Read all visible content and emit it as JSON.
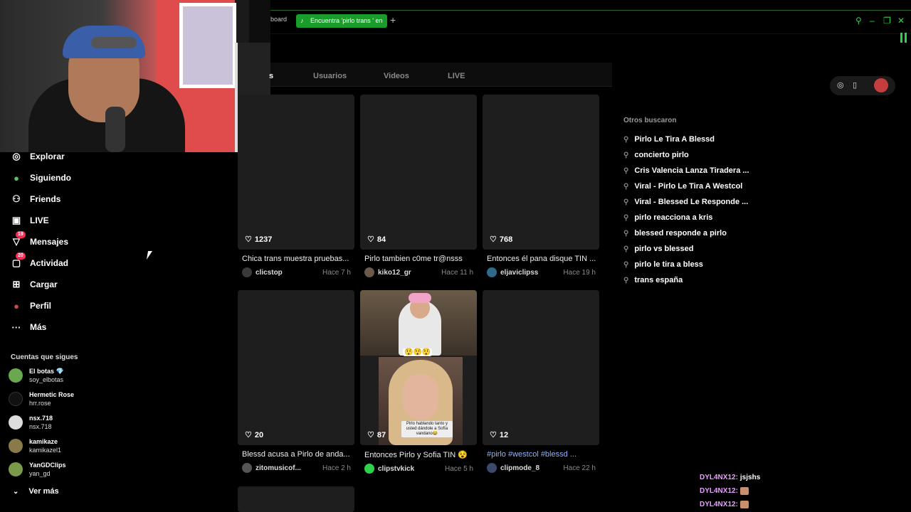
{
  "browser": {
    "prev_tab": "board",
    "active_tab": "Encuentra 'pirlo trans ' en",
    "new_tab": "+",
    "controls": [
      "⚲",
      "–",
      "❐",
      "✕"
    ]
  },
  "sidebar": {
    "items": [
      {
        "label": "Explorar",
        "icon": "compass-icon",
        "glyph": "◎"
      },
      {
        "label": "Siguiendo",
        "icon": "following-avatar-icon",
        "glyph": "●"
      },
      {
        "label": "Friends",
        "icon": "friends-icon",
        "glyph": "⚇"
      },
      {
        "label": "LIVE",
        "icon": "live-tv-icon",
        "glyph": "▣"
      },
      {
        "label": "Mensajes",
        "icon": "messages-icon",
        "glyph": "▽",
        "badge": "19"
      },
      {
        "label": "Actividad",
        "icon": "activity-icon",
        "glyph": "▢",
        "badge": "20"
      },
      {
        "label": "Cargar",
        "icon": "upload-plus-icon",
        "glyph": "⊞"
      },
      {
        "label": "Perfil",
        "icon": "profile-avatar-icon",
        "glyph": "●"
      },
      {
        "label": "Más",
        "icon": "more-dots-icon",
        "glyph": "···"
      }
    ],
    "following_title": "Cuentas que sigues",
    "following": [
      {
        "name": "El botas 💎",
        "handle": "soy_elbotas",
        "color": "#6aa84f"
      },
      {
        "name": "Hermetic Rose",
        "handle": "hrr.rose",
        "color": "#111111"
      },
      {
        "name": "nsx.718",
        "handle": "nsx.718",
        "color": "#dddddd"
      },
      {
        "name": "kamikaze",
        "handle": "kamikazel1",
        "color": "#8a7a4a"
      },
      {
        "name": "YanGDClips",
        "handle": "yan_gd",
        "color": "#7a9a4a"
      }
    ],
    "see_more": "Ver más"
  },
  "tabs": [
    "s",
    "Usuarios",
    "Videos",
    "LIVE"
  ],
  "videos": [
    {
      "likes": "1237",
      "caption": "Chica trans muestra pruebas...",
      "user": "clicstop",
      "time": "Hace 7 h"
    },
    {
      "likes": "84",
      "caption": "Pirlo tambien c0me tr@nsss",
      "user": "kiko12_gr",
      "time": "Hace 11 h"
    },
    {
      "likes": "768",
      "caption": "Entonces él pana disque TIN ...",
      "user": "eljaviclipss",
      "time": "Hace 19 h"
    },
    {
      "likes": "20",
      "caption": "Blessd acusa a Pirlo de anda...",
      "user": "zitomusicof...",
      "time": "Hace 2 h"
    },
    {
      "likes": "87",
      "caption": "Entonces Pirlo y Sofia TIN 😵",
      "user": "clipstvkick",
      "time": "Hace 5 h",
      "emojis": "😲😲😲",
      "subtitle": "Pirlo hablando tanto y usted dándole a Sofía vandano😂"
    },
    {
      "likes": "12",
      "caption": "#pirlo #westcol #blessd ...",
      "user": "clipmode_8",
      "time": "Hace 22 h"
    }
  ],
  "right": {
    "controls": [
      "◎",
      "▯"
    ],
    "others_title": "Otros buscaron",
    "suggestions": [
      "Pirlo Le Tira A Blessd",
      "concierto pirlo",
      "Cris Valencia Lanza Tiradera ...",
      "Viral - Pirlo Le Tira A Westcol",
      "Viral - Blessed Le Responde ...",
      "pirlo reacciona a kris",
      "blessed responde a pirlo",
      "pirlo vs blessed",
      "pirlo le tira a bless",
      "trans españa"
    ]
  },
  "chat": [
    {
      "user": "DYL4NX12:",
      "message": "jsjshs"
    },
    {
      "user": "DYL4NX12:",
      "message": ""
    },
    {
      "user": "DYL4NX12:",
      "message": ""
    }
  ],
  "colors": {
    "accent": "#1a9c2a",
    "badge": "#fe2c55",
    "tags": "#8fb4ff"
  }
}
